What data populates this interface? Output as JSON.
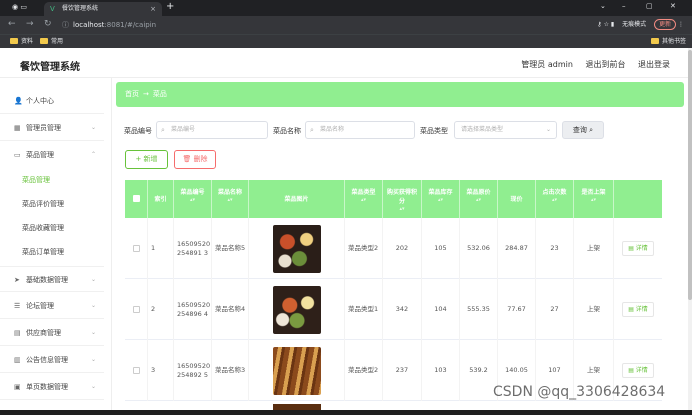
{
  "browser": {
    "tab_title": "餐饮管理系统",
    "url_host": "localhost",
    "url_rest": ":8081/#/caipin",
    "incognito_label": "无痕模式",
    "update_label": "更新",
    "bookmarks": [
      "资料",
      "常用"
    ],
    "other_bookmarks": "其他书签"
  },
  "header": {
    "title": "餐饮管理系统",
    "user": "管理员 admin",
    "back_front": "退出到前台",
    "logout": "退出登录"
  },
  "sidebar": {
    "items": [
      {
        "label": "个人中心",
        "icon": "user-icon"
      },
      {
        "label": "管理员管理",
        "icon": "admin-icon"
      },
      {
        "label": "菜品管理",
        "icon": "dish-icon"
      },
      {
        "label": "基础数据管理",
        "icon": "send-icon"
      },
      {
        "label": "论坛管理",
        "icon": "sliders-icon"
      },
      {
        "label": "供应商管理",
        "icon": "supplier-icon"
      },
      {
        "label": "公告信息管理",
        "icon": "chart-icon"
      },
      {
        "label": "单页数据管理",
        "icon": "page-icon"
      }
    ],
    "sub_items": [
      "菜品管理",
      "菜品评价管理",
      "菜品收藏管理",
      "菜品订单管理"
    ]
  },
  "breadcrumb": {
    "home": "首页",
    "current": "菜品"
  },
  "filters": {
    "code_label": "菜品编号",
    "code_placeholder": "菜品编号",
    "name_label": "菜品名称",
    "name_placeholder": "菜品名称",
    "type_label": "菜品类型",
    "type_placeholder": "请选择菜品类型",
    "search_label": "查询"
  },
  "actions": {
    "add": "新增",
    "delete": "删除"
  },
  "table": {
    "headers": [
      "索引",
      "菜品编号",
      "菜品名称",
      "菜品图片",
      "菜品类型",
      "购买获得积分",
      "菜品库存",
      "菜品原价",
      "现价",
      "点击次数",
      "是否上架"
    ],
    "detail_label": "详情",
    "rows": [
      {
        "index": "1",
        "code": "16509520254891 3",
        "name": "菜品名称5",
        "type": "菜品类型2",
        "points": "202",
        "stock": "105",
        "orig": "532.06",
        "price": "284.87",
        "clicks": "23",
        "onsale": "上架"
      },
      {
        "index": "2",
        "code": "16509520254896 4",
        "name": "菜品名称4",
        "type": "菜品类型1",
        "points": "342",
        "stock": "104",
        "orig": "555.35",
        "price": "77.67",
        "clicks": "27",
        "onsale": "上架"
      },
      {
        "index": "3",
        "code": "16509520254892 5",
        "name": "菜品名称3",
        "type": "菜品类型2",
        "points": "237",
        "stock": "103",
        "orig": "539.2",
        "price": "140.05",
        "clicks": "107",
        "onsale": "上架"
      }
    ]
  },
  "watermark": "CSDN @qq_3306428634"
}
